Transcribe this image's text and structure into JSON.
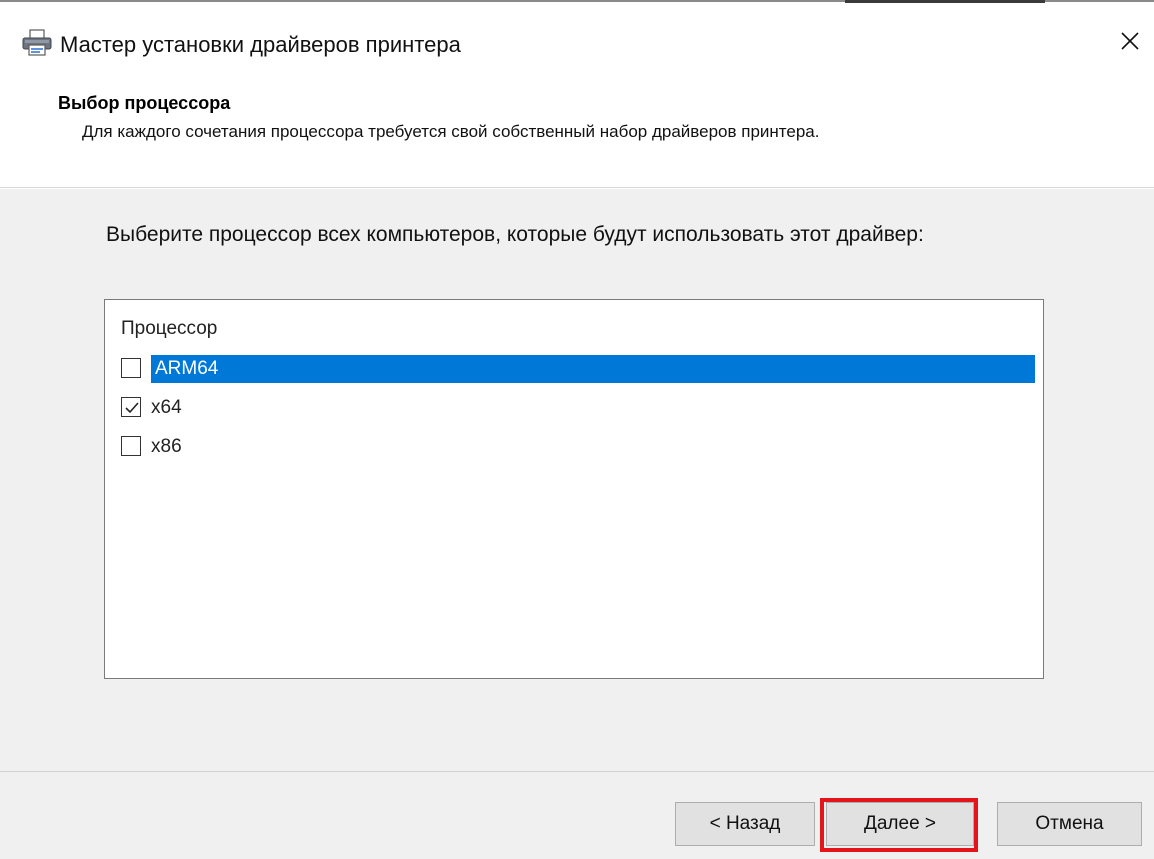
{
  "window": {
    "title": "Мастер установки драйверов принтера",
    "icon": "printer-icon",
    "close_icon": "close-icon"
  },
  "header": {
    "title": "Выбор процессора",
    "description": "Для каждого сочетания процессора требуется свой собственный набор драйверов принтера."
  },
  "main": {
    "prompt": "Выберите процессор всех компьютеров, которые будут использовать этот драйвер:",
    "list": {
      "header": "Процессор",
      "items": [
        {
          "label": "ARM64",
          "checked": false,
          "selected": true
        },
        {
          "label": "x64",
          "checked": true,
          "selected": false
        },
        {
          "label": "x86",
          "checked": false,
          "selected": false
        }
      ]
    }
  },
  "footer": {
    "back_label": "< Назад",
    "next_label": "Далее >",
    "cancel_label": "Отмена"
  },
  "colors": {
    "selection": "#0078d7",
    "highlight": "#e3151a",
    "content_bg": "#f0f0f0"
  }
}
